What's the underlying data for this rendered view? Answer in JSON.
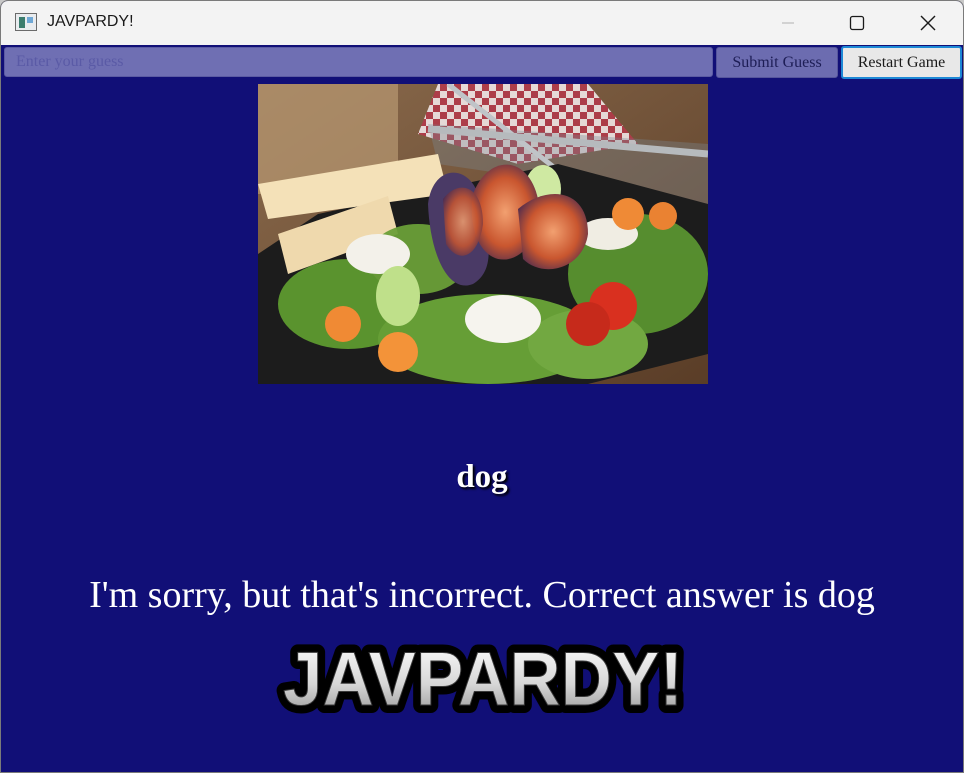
{
  "window": {
    "title": "JAVPARDY!"
  },
  "toolbar": {
    "guess_placeholder": "Enter your guess",
    "submit_label": "Submit Guess",
    "restart_label": "Restart Game"
  },
  "question": {
    "image_subject": "salad with figs, cheese, tomatoes and bread",
    "answer_word": "dog"
  },
  "feedback": {
    "message": "I'm sorry, but that's incorrect. Correct answer is dog"
  },
  "logo": {
    "text": "JAVPARDY!"
  },
  "colors": {
    "background": "#110f77",
    "input_bg": "#6f6fb3",
    "restart_border": "#1d88d6"
  }
}
